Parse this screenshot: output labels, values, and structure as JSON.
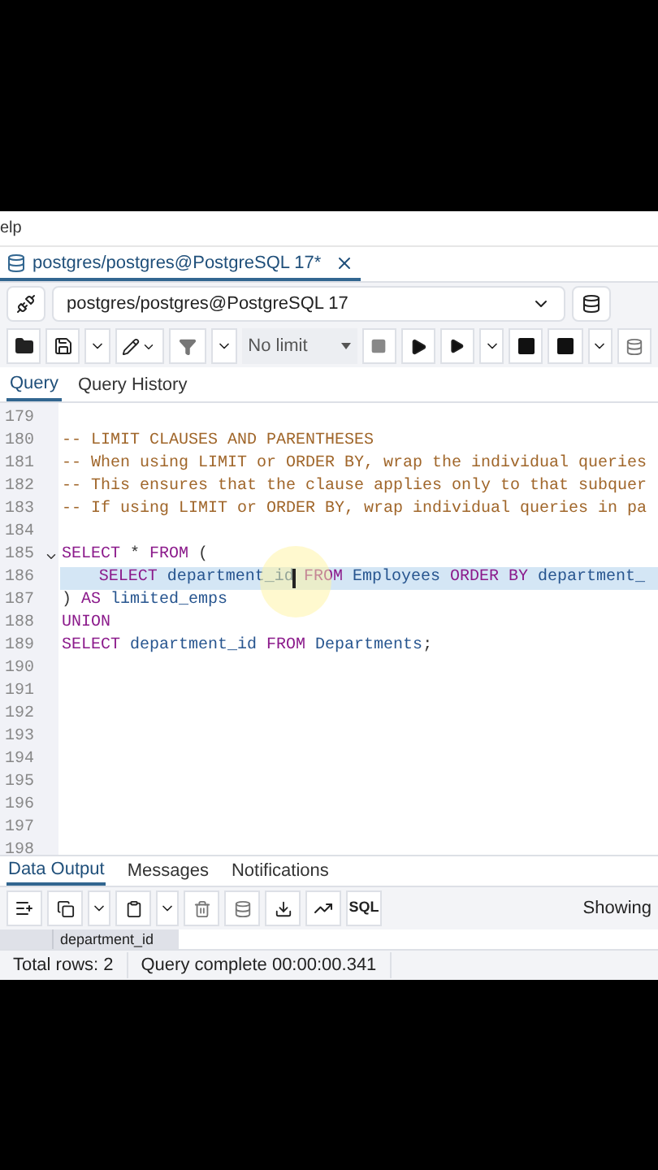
{
  "menu": {
    "label": "elp"
  },
  "editor_tab": {
    "label": "postgres/postgres@PostgreSQL 17*",
    "selected": true
  },
  "connection": {
    "value": "postgres/postgres@PostgreSQL 17"
  },
  "toolbar": {
    "limit": "No limit"
  },
  "query_tabs": [
    {
      "label": "Query",
      "selected": true
    },
    {
      "label": "Query History",
      "selected": false
    }
  ],
  "editor": {
    "lines": [
      {
        "number": "179"
      },
      {
        "number": "180",
        "tokens": [
          {
            "kind": "comment",
            "text": "-- LIMIT CLAUSES AND PARENTHESES"
          }
        ]
      },
      {
        "number": "181",
        "tokens": [
          {
            "kind": "comment",
            "text": "-- When using LIMIT or ORDER BY, wrap the individual queries"
          }
        ]
      },
      {
        "number": "182",
        "tokens": [
          {
            "kind": "comment",
            "text": "-- This ensures that the clause applies only to that subquer"
          }
        ]
      },
      {
        "number": "183",
        "tokens": [
          {
            "kind": "comment",
            "text": "-- If using LIMIT or ORDER BY, wrap individual queries in pa"
          }
        ]
      },
      {
        "number": "184"
      },
      {
        "number": "185",
        "fold": true,
        "tokens": [
          {
            "kind": "keyword",
            "text": "SELECT"
          },
          {
            "kind": "plain",
            "text": " * "
          },
          {
            "kind": "keyword",
            "text": "FROM"
          },
          {
            "kind": "plain",
            "text": " ("
          }
        ]
      },
      {
        "number": "186",
        "selected": true,
        "tokens": [
          {
            "kind": "keyword",
            "text": "    SELECT"
          },
          {
            "kind": "ident",
            "text": " department_id "
          },
          {
            "kind": "keyword",
            "text": "FROM"
          },
          {
            "kind": "ident",
            "text": " Employees "
          },
          {
            "kind": "keyword",
            "text": "ORDER BY"
          },
          {
            "kind": "ident",
            "text": " department_"
          }
        ]
      },
      {
        "number": "187",
        "tokens": [
          {
            "kind": "plain",
            "text": ") "
          },
          {
            "kind": "keyword",
            "text": "AS"
          },
          {
            "kind": "ident",
            "text": " limited_emps"
          }
        ]
      },
      {
        "number": "188",
        "tokens": [
          {
            "kind": "keyword",
            "text": "UNION"
          }
        ]
      },
      {
        "number": "189",
        "tokens": [
          {
            "kind": "keyword",
            "text": "SELECT"
          },
          {
            "kind": "ident",
            "text": " department_id "
          },
          {
            "kind": "keyword",
            "text": "FROM"
          },
          {
            "kind": "ident",
            "text": " Departments"
          },
          {
            "kind": "plain",
            "text": ";"
          }
        ]
      },
      {
        "number": "190"
      },
      {
        "number": "191"
      },
      {
        "number": "192"
      },
      {
        "number": "193"
      },
      {
        "number": "194"
      },
      {
        "number": "195"
      },
      {
        "number": "196"
      },
      {
        "number": "197"
      },
      {
        "number": "198"
      }
    ]
  },
  "output_tabs": [
    {
      "label": "Data Output",
      "selected": true
    },
    {
      "label": "Messages",
      "selected": false
    },
    {
      "label": "Notifications",
      "selected": false
    }
  ],
  "output_toolbar": {
    "sql_button": "SQL",
    "showing": "Showing"
  },
  "grid": {
    "columns": [
      "department_id"
    ]
  },
  "status_bar": {
    "rows": "Total rows: 2",
    "message": "Query complete 00:00:00.341"
  }
}
